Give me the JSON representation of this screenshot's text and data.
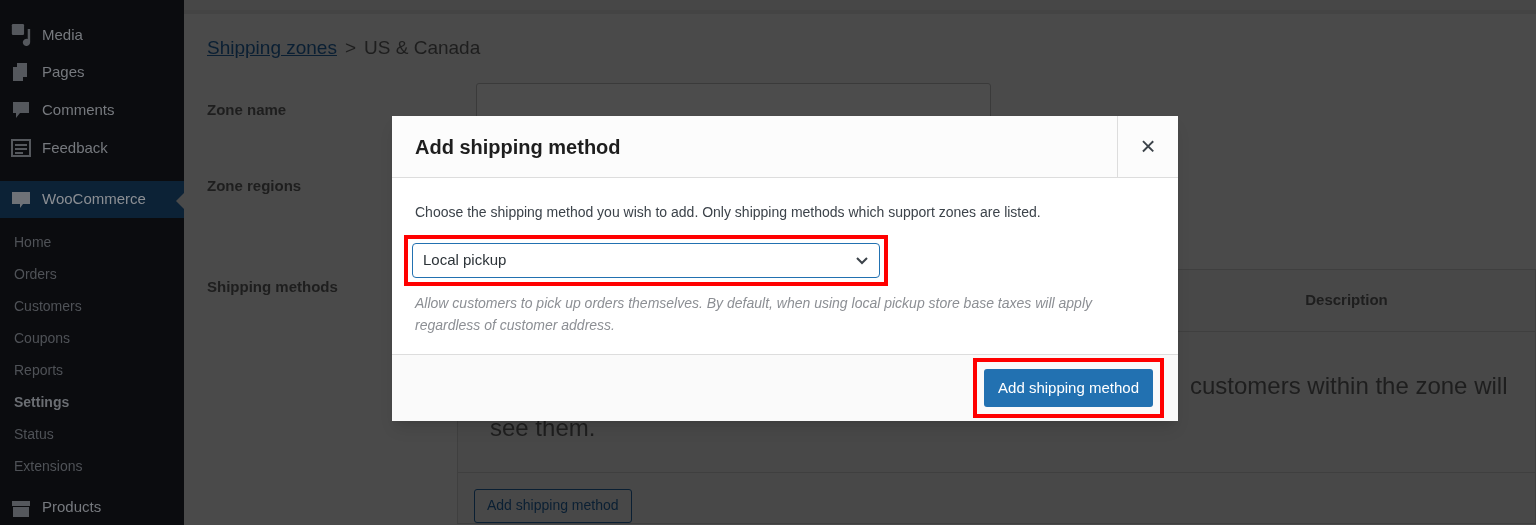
{
  "sidebar": {
    "items": [
      {
        "label": "Media",
        "selected": false
      },
      {
        "label": "Pages",
        "selected": false
      },
      {
        "label": "Comments",
        "selected": false
      },
      {
        "label": "Feedback",
        "selected": false
      },
      {
        "label": "WooCommerce",
        "selected": true
      }
    ],
    "submenu": [
      {
        "label": "Home",
        "selected": false
      },
      {
        "label": "Orders",
        "selected": false
      },
      {
        "label": "Customers",
        "selected": false
      },
      {
        "label": "Coupons",
        "selected": false
      },
      {
        "label": "Reports",
        "selected": false
      },
      {
        "label": "Settings",
        "selected": true
      },
      {
        "label": "Status",
        "selected": false
      },
      {
        "label": "Extensions",
        "selected": false
      }
    ],
    "bottom_items": [
      {
        "label": "Products",
        "selected": false
      }
    ]
  },
  "breadcrumb": {
    "link": "Shipping zones",
    "separator": ">",
    "current": "US & Canada"
  },
  "form": {
    "labels": [
      "Zone name",
      "Zone regions",
      "Shipping methods"
    ]
  },
  "table": {
    "columns": [
      "Description"
    ],
    "message_line_1": "customers within the zone will",
    "message_line_2": "see them.",
    "add_button": "Add shipping method"
  },
  "modal": {
    "title": "Add shipping method",
    "close": "×",
    "intro": "Choose the shipping method you wish to add. Only shipping methods which support zones are listed.",
    "select": {
      "value": "Local pickup",
      "highlighted": true
    },
    "help": "Allow customers to pick up orders themselves. By default, when using local pickup store base taxes will apply regardless of customer address.",
    "button": {
      "label": "Add shipping method",
      "highlighted": true
    }
  }
}
